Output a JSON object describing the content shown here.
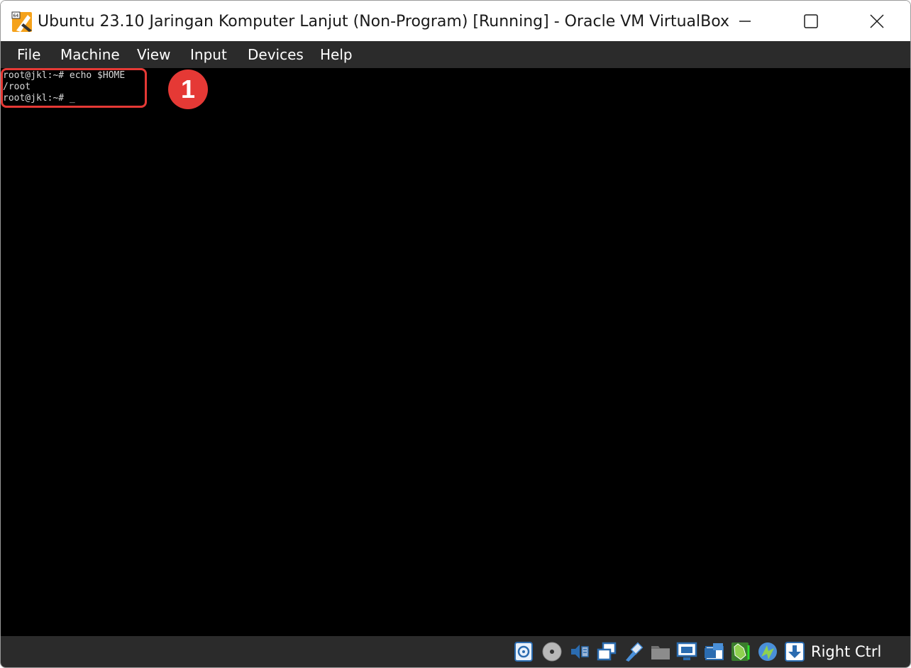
{
  "window": {
    "title": "Ubuntu 23.10 Jaringan Komputer Lanjut (Non-Program) [Running] - Oracle VM VirtualBox",
    "app_icon": "virtualbox-vm-64-icon",
    "controls": [
      "minimize-icon",
      "maximize-icon",
      "close-icon"
    ]
  },
  "menubar": {
    "items": [
      "File",
      "Machine",
      "View",
      "Input",
      "Devices",
      "Help"
    ]
  },
  "terminal": {
    "lines": [
      "root@jkl:~# echo $HOME",
      "/root",
      "root@jkl:~# "
    ],
    "cursor": "_"
  },
  "annotation": {
    "step_number": "1",
    "color": "#e53935"
  },
  "statusbar": {
    "icons": [
      "hard-disk-icon",
      "optical-drive-icon",
      "audio-icon",
      "network-icon",
      "usb-icon",
      "shared-folders-icon",
      "display-icon",
      "recording-icon",
      "cpu-activity-icon",
      "mouse-integration-icon",
      "keyboard-capture-icon"
    ],
    "host_key": "Right Ctrl"
  }
}
